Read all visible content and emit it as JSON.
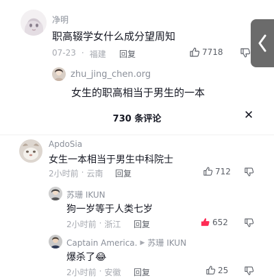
{
  "top_comment": {
    "author": "净明",
    "text": "职高辍学女什么成分望周知",
    "date": "07-23",
    "location": "福建",
    "reply_label": "回复",
    "likes": "7718"
  },
  "quoted_reply": {
    "author": "zhu_jing_chen.org",
    "text": "女生的职高相当于男生的一本"
  },
  "sheet": {
    "title": "730 条评论",
    "close_label": "✕"
  },
  "comments": [
    {
      "author": "ApdoSia",
      "text": "女生一本相当于男生中科院士",
      "time": "2小时前",
      "location": "云南",
      "reply_label": "回复",
      "likes": "712"
    },
    {
      "author": "苏珊 IKUN",
      "text": "狗一岁等于人类七岁",
      "time": "2小时前",
      "location": "浙江",
      "reply_label": "回复",
      "likes": "652",
      "liked": true
    },
    {
      "author": "Captain America.",
      "reply_to": "苏珊 IKUN",
      "text": "爆杀了",
      "emoji": "😂",
      "time": "2小时前",
      "location": "安徽",
      "reply_label": "回复",
      "likes": "25"
    }
  ],
  "colors": {
    "liked_red": "#fe2c55",
    "meta_gray": "#a6a9b0",
    "name_gray": "#8a8f99",
    "handle_gray": "#6b6b6b"
  }
}
